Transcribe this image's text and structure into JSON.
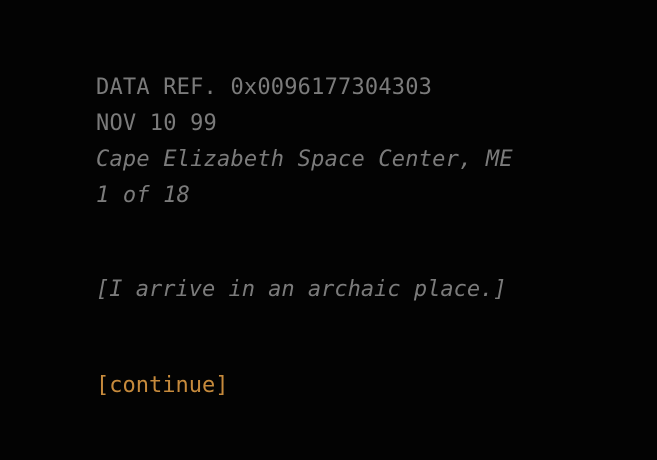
{
  "header": {
    "data_ref": "DATA REF. 0x0096177304303",
    "date": "NOV 10 99",
    "location": "Cape Elizabeth Space Center, ME",
    "page_count": "1 of 18"
  },
  "narration": "[I arrive in an archaic place.]",
  "continue_label": "[continue]",
  "colors": {
    "background": "#030303",
    "text": "#7b7b7b",
    "link": "#c68a3c"
  }
}
